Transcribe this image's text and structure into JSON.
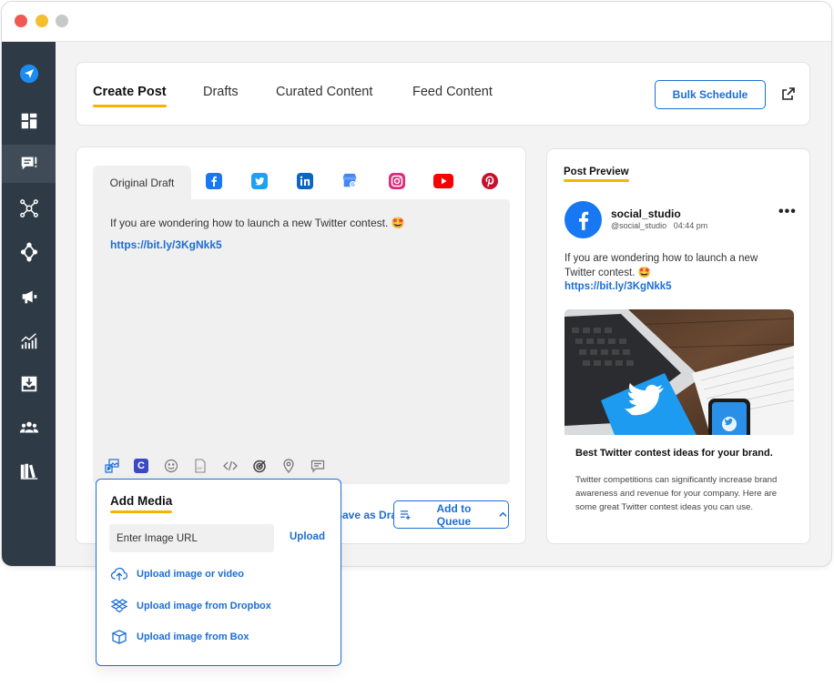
{
  "nav_tabs": [
    {
      "label": "Create Post",
      "active": true
    },
    {
      "label": "Drafts",
      "active": false
    },
    {
      "label": "Curated Content",
      "active": false
    },
    {
      "label": "Feed Content",
      "active": false
    }
  ],
  "bulk_schedule_label": "Bulk Schedule",
  "sidebar": {
    "items": [
      {
        "icon": "paper-plane-icon"
      },
      {
        "icon": "dashboard-icon"
      },
      {
        "icon": "compose-icon",
        "active": true
      },
      {
        "icon": "network-icon"
      },
      {
        "icon": "move-icon"
      },
      {
        "icon": "megaphone-icon"
      },
      {
        "icon": "analytics-icon"
      },
      {
        "icon": "inbox-icon"
      },
      {
        "icon": "team-icon"
      },
      {
        "icon": "library-icon"
      }
    ]
  },
  "editor": {
    "original_tab": "Original Draft",
    "networks": [
      "facebook",
      "twitter",
      "linkedin",
      "google-business",
      "instagram",
      "youtube",
      "pinterest"
    ],
    "text": "If you are wondering how to launch a new Twitter contest.",
    "emoji": "🤩",
    "link": "https://bit.ly/3KgNkk5",
    "save_draft_label": "Save as Draft",
    "add_queue_label": "Add to Queue"
  },
  "add_media": {
    "title": "Add Media",
    "url_placeholder": "Enter Image URL",
    "upload_label": "Upload",
    "options": [
      {
        "label": "Upload image or video",
        "icon": "cloud-upload-icon"
      },
      {
        "label": "Upload image from Dropbox",
        "icon": "dropbox-icon"
      },
      {
        "label": "Upload image from Box",
        "icon": "box-icon"
      }
    ]
  },
  "preview": {
    "title": "Post Preview",
    "account_name": "social_studio",
    "handle": "@social_studio",
    "time": "04:44 pm",
    "text": "If you are wondering how to launch a new Twitter contest.",
    "emoji": "🤩",
    "link": "https://bit.ly/3KgNkk5",
    "card_title": "Best Twitter contest ideas for your brand.",
    "card_desc": "Twitter competitions can significantly increase brand awareness and revenue for your company. Here are some great Twitter contest ideas you can use."
  },
  "colors": {
    "accent": "#1b6ed6",
    "underline": "#f5b400",
    "sidebar": "#2e3a45"
  }
}
